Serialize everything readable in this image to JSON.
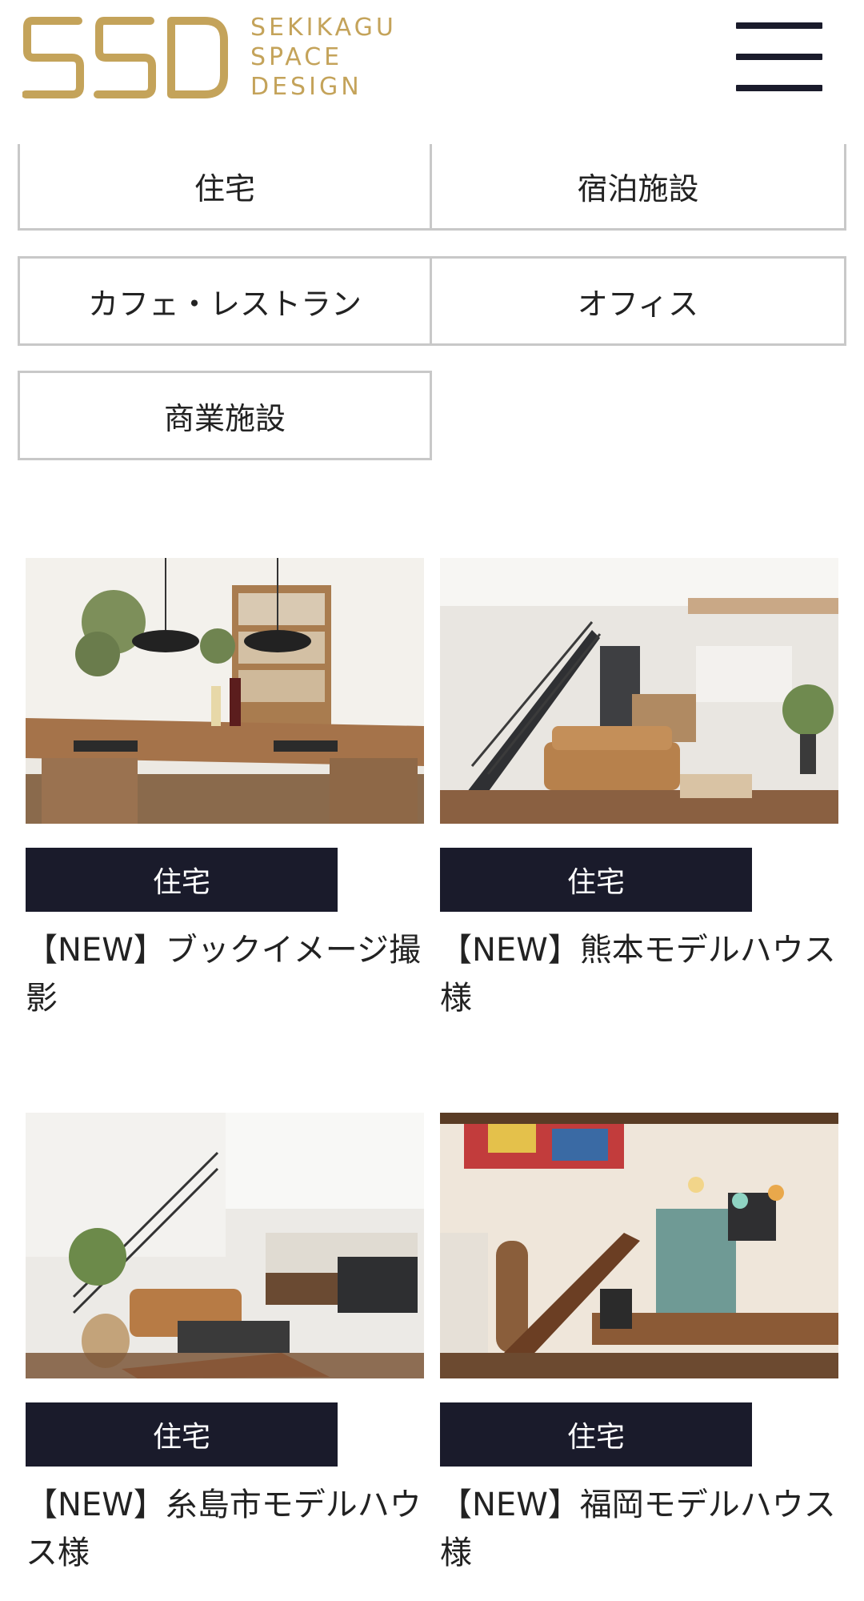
{
  "header": {
    "logo_lines": [
      "SEKIKAGU",
      "SPACE",
      "DESIGN"
    ],
    "brand_color": "#c4a35a",
    "menu_icon": "hamburger-menu-icon"
  },
  "categories": [
    {
      "label": "住宅"
    },
    {
      "label": "宿泊施設"
    },
    {
      "label": "カフェ・レストラン"
    },
    {
      "label": "オフィス"
    },
    {
      "label": "商業施設"
    }
  ],
  "cards": [
    {
      "tag": "住宅",
      "title": "【NEW】ブックイメージ撮影"
    },
    {
      "tag": "住宅",
      "title": "【NEW】熊本モデルハウス様"
    },
    {
      "tag": "住宅",
      "title": "【NEW】糸島市モデルハウス様"
    },
    {
      "tag": "住宅",
      "title": "【NEW】福岡モデルハウス様"
    }
  ],
  "colors": {
    "tag_bg": "#1a1b2b",
    "border": "#c8c8c8"
  }
}
